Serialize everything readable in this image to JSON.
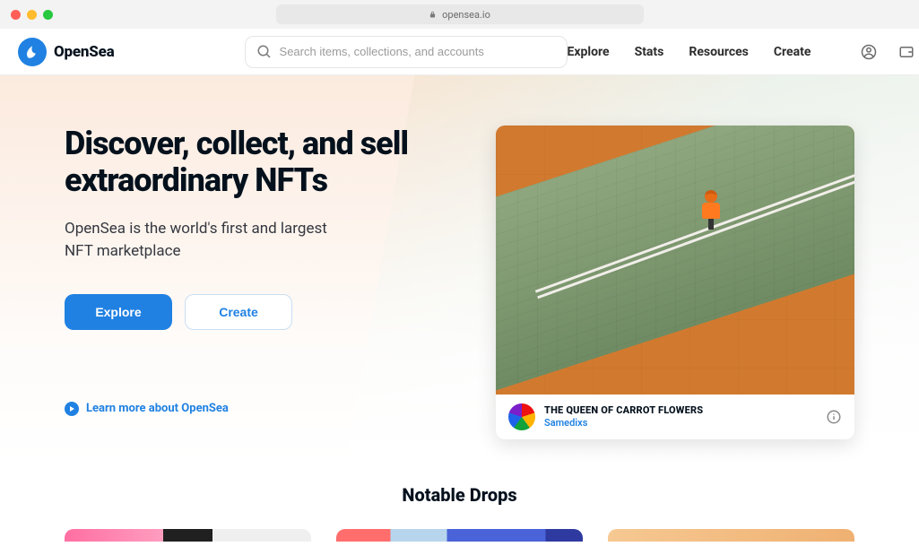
{
  "chrome": {
    "url": "opensea.io"
  },
  "brand": {
    "name": "OpenSea"
  },
  "search": {
    "placeholder": "Search items, collections, and accounts"
  },
  "nav": {
    "links": [
      "Explore",
      "Stats",
      "Resources",
      "Create"
    ]
  },
  "hero": {
    "title": "Discover, collect, and sell extraordinary NFTs",
    "subtitle": "OpenSea is the world's first and largest NFT marketplace",
    "primary_cta": "Explore",
    "secondary_cta": "Create",
    "learn_more": "Learn more about OpenSea"
  },
  "featured": {
    "title": "THE QUEEN OF CARROT FLOWERS",
    "author": "Samedixs"
  },
  "section": {
    "notable": "Notable Drops"
  },
  "colors": {
    "primary": "#2081e2"
  }
}
